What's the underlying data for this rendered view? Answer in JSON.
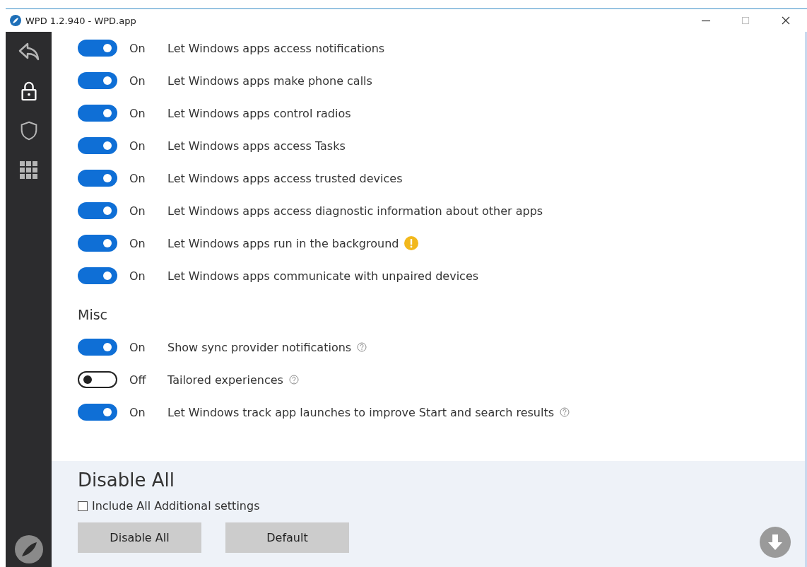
{
  "window": {
    "title": "WPD 1.2.940 - WPD.app"
  },
  "sidebar": {
    "items": [
      {
        "kind": "back",
        "selected": false
      },
      {
        "kind": "lock",
        "selected": true
      },
      {
        "kind": "shield",
        "selected": false
      },
      {
        "kind": "grid",
        "selected": false
      }
    ]
  },
  "sections": [
    {
      "settings": [
        {
          "on": true,
          "state": "On",
          "label": "Let Windows apps access notifications",
          "kind": "plain"
        },
        {
          "on": true,
          "state": "On",
          "label": "Let Windows apps make phone calls",
          "kind": "plain"
        },
        {
          "on": true,
          "state": "On",
          "label": "Let Windows apps control radios",
          "kind": "plain"
        },
        {
          "on": true,
          "state": "On",
          "label": "Let Windows apps access Tasks",
          "kind": "plain"
        },
        {
          "on": true,
          "state": "On",
          "label": "Let Windows apps access trusted devices",
          "kind": "plain"
        },
        {
          "on": true,
          "state": "On",
          "label": "Let Windows apps access diagnostic information about other apps",
          "kind": "plain"
        },
        {
          "on": true,
          "state": "On",
          "label": "Let Windows apps run in the background",
          "kind": "warning"
        },
        {
          "on": true,
          "state": "On",
          "label": "Let Windows apps communicate with unpaired devices",
          "kind": "plain"
        }
      ]
    },
    {
      "title": "Misc",
      "settings": [
        {
          "on": true,
          "state": "On",
          "label": "Show sync provider notifications",
          "kind": "help"
        },
        {
          "on": false,
          "state": "Off",
          "label": "Tailored experiences",
          "kind": "help"
        },
        {
          "on": true,
          "state": "On",
          "label": "Let Windows track app launches to improve Start and search results",
          "kind": "help"
        }
      ]
    }
  ],
  "footer": {
    "title": "Disable All",
    "checkbox": {
      "label": "Include All Additional settings",
      "checked": false
    },
    "buttons": [
      "Disable All",
      "Default"
    ]
  }
}
